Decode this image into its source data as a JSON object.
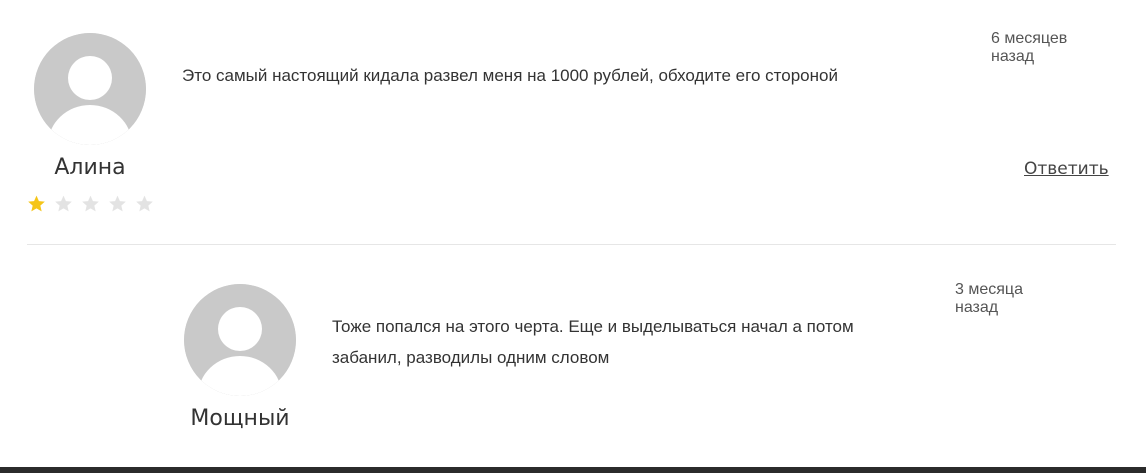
{
  "comments": [
    {
      "author": "Алина",
      "text_lines": [
        "Это самый настоящий кидала развел меня на 1000 рублей, обходите его стороной"
      ],
      "time_lines": [
        "6 месяцев",
        "назад"
      ],
      "reply_label": "Ответить",
      "rating": {
        "value": 1,
        "max": 5
      },
      "avatar_icon": "user-avatar-icon"
    },
    {
      "author": "Мощный",
      "text_lines": [
        "Тоже попался на этого черта. Еще и выделываться начал а потом",
        "забанил, разводилы одним словом"
      ],
      "time_lines": [
        "3 месяца",
        "назад"
      ],
      "avatar_icon": "user-avatar-icon"
    }
  ],
  "colors": {
    "star_filled": "#f5c518",
    "star_empty": "#e3e3e3",
    "avatar_bg": "#c9c9c9",
    "avatar_figure": "#ffffff",
    "divider": "#e6e6e6",
    "footer_bar": "#2b2b2b"
  }
}
